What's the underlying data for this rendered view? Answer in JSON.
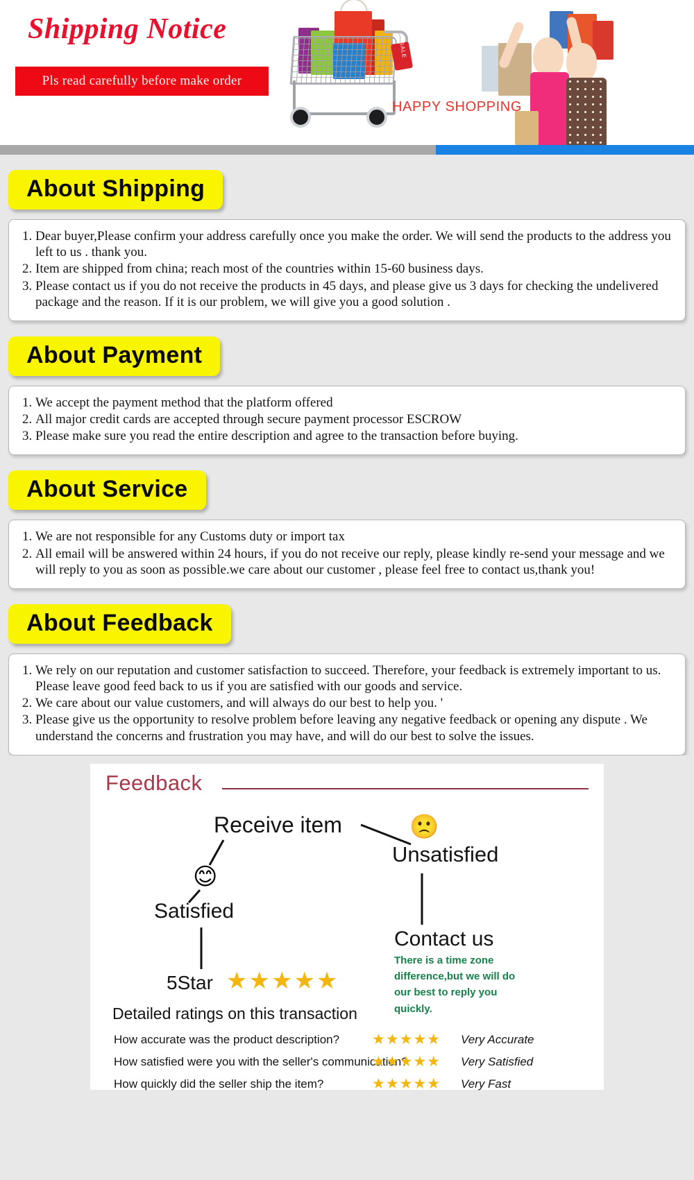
{
  "header": {
    "title": "Shipping Notice",
    "subbar": "Pls read carefully before make order",
    "happy_shopping": "HAPPY SHOPPING",
    "cart_sale_tag": "SALE",
    "divider": {
      "grey": "#a8a8a8",
      "blue": "#1a82e2"
    },
    "colors": {
      "title": "#e8112d",
      "subbar_bg": "#ee0a14",
      "subbar_text": "#fff3f0"
    }
  },
  "sections": [
    {
      "tag": "About Shipping",
      "items": [
        "Dear buyer,Please confirm your address carefully once you make the order. We will send the products to the address you left to us . thank you.",
        "Item are shipped from china; reach most of the countries within 15-60 business days.",
        "Please contact us if you do not receive the products in 45 days, and please give us 3 days for checking the undelivered package and the reason. If it is our problem, we will give you a good solution ."
      ]
    },
    {
      "tag": "About Payment",
      "items": [
        "We accept the payment method that the platform offered",
        "All major credit cards are accepted through secure payment processor ESCROW",
        "Please make sure you read the entire description and agree to the transaction before buying."
      ]
    },
    {
      "tag": "About Service",
      "items": [
        "We are not responsible for any Customs duty or import tax",
        "All email will be answered within 24 hours, if you do not receive our reply, please kindly re-send your message and we will reply to you as soon as possible.we care about our customer , please feel free to contact us,thank you!"
      ]
    },
    {
      "tag": "About Feedback",
      "items": [
        "We rely on our reputation and customer satisfaction to succeed. Therefore, your feedback is extremely important to us. Please leave good feed back to us if you are satisfied with our goods and service.",
        "We care about our value customers, and will always do our best to help you. '",
        "Please give us the opportunity to resolve problem before leaving any negative feedback or opening any dispute . We understand the concerns and frustration you may have, and will do our best to solve the issues."
      ]
    }
  ],
  "feedback_diagram": {
    "title": "Feedback",
    "title_color": "#a53a4c",
    "receive_item": "Receive item",
    "satisfied": "Satisfied",
    "unsatisfied": "Unsatisfied",
    "satisfied_emoji": "😊",
    "unsatisfied_emoji": "🙁",
    "five_star_label": "5Star",
    "five_stars": "★★★★★",
    "contact_us": "Contact us",
    "contact_note": "There is a time zone difference,but we will do our best to reply you quickly.",
    "contact_note_color": "#18804a",
    "detailed_ratings_label": "Detailed ratings on this transaction",
    "ratings": [
      {
        "question": "How accurate was the product description?",
        "stars": "★★★★★",
        "verdict": "Very Accurate"
      },
      {
        "question": "How satisfied were you with the seller's communication?",
        "stars": "★★★★★",
        "verdict": "Very Satisfied"
      },
      {
        "question": "How quickly did the seller ship the item?",
        "stars": "★★★★★",
        "verdict": "Very Fast"
      }
    ],
    "star_color": "#f3b611"
  }
}
